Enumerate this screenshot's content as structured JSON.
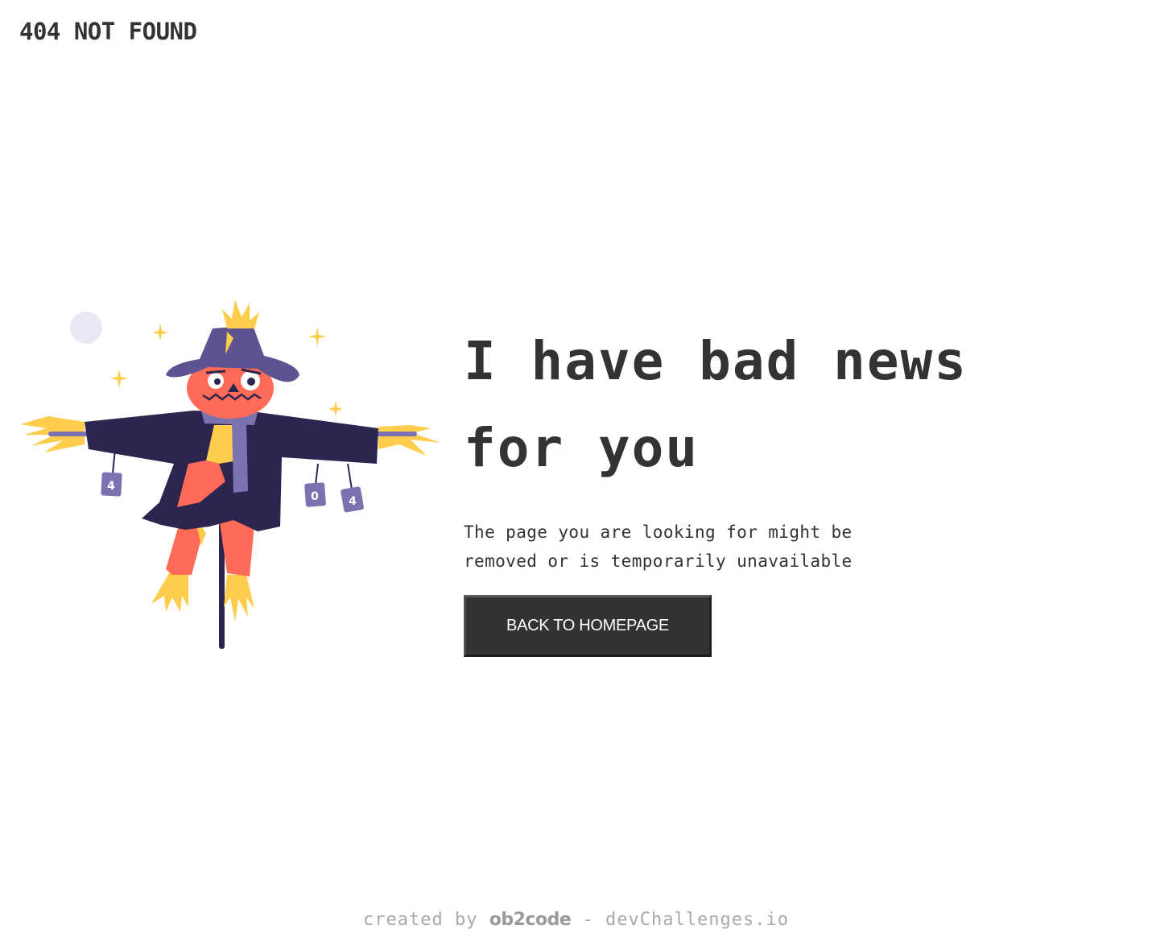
{
  "header": {
    "brand": "404 NOT FOUND"
  },
  "illustration": {
    "icon": "scarecrow-illustration",
    "can_labels": [
      "4",
      "0",
      "4"
    ]
  },
  "main": {
    "headline_line1": "I have bad news",
    "headline_line2": "for you",
    "message_line1": "The page you are looking for might be",
    "message_line2": "removed or is temporarily unavailable",
    "button_label": "BACK TO HOMEPAGE"
  },
  "footer": {
    "prefix": "created by",
    "author": "ob2code",
    "separator": "-",
    "site": "devChallenges.io"
  },
  "colors": {
    "text": "#333333",
    "button_bg": "#333333",
    "button_text": "#ffffff",
    "footer_text": "#a9a9a9",
    "coat": "#2d2550",
    "hat": "#5e5391",
    "face": "#ff6b57",
    "straw": "#ffcd4b",
    "moon": "#e8e9f5"
  }
}
